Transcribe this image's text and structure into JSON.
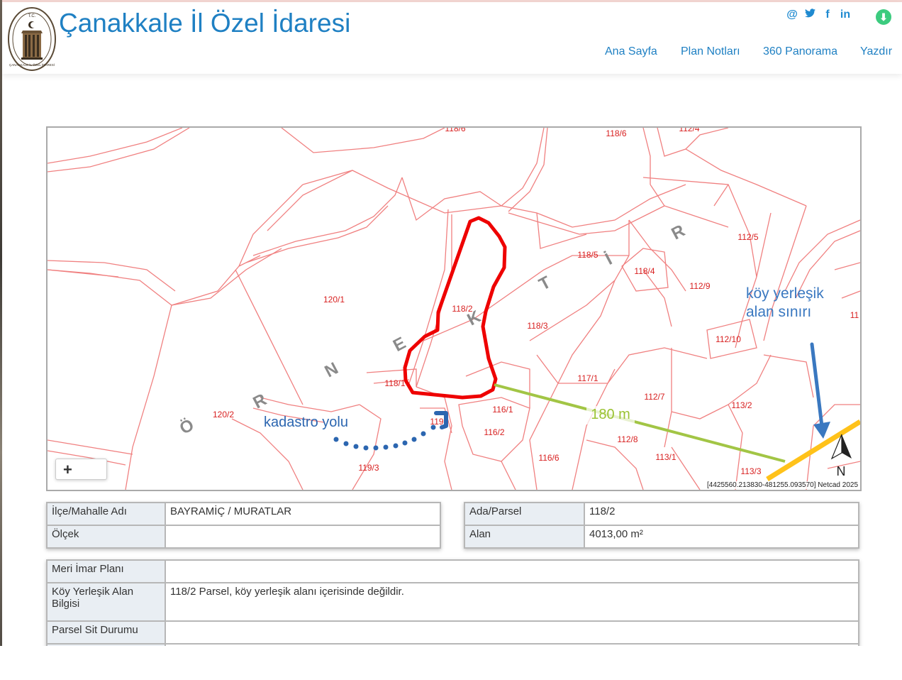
{
  "header": {
    "title": "Çanakkale İl Özel İdaresi",
    "logo_text": "T.C. ÇANAKKALE İL ÖZEL İDARESİ",
    "social": [
      "@",
      "twitter",
      "f",
      "in"
    ],
    "nav": [
      "Ana Sayfa",
      "Plan Notları",
      "360 Panorama",
      "Yazdır"
    ]
  },
  "map": {
    "parcels": [
      "118/6",
      "112/4",
      "118/5",
      "118/4",
      "112/5",
      "112/9",
      "120/1",
      "118/2",
      "118/3",
      "112/10",
      "117/1",
      "118/1",
      "116/1",
      "112/7",
      "113/2",
      "120/2",
      "119",
      "116/2",
      "112/8",
      "116/6",
      "113/1",
      "119/3",
      "113/3",
      "11"
    ],
    "street_letters": [
      "Ö",
      "R",
      "N",
      "E",
      "K",
      "T",
      "İ",
      "R"
    ],
    "annotations": {
      "village_boundary": [
        "köy yerleşik",
        "alan sınırı"
      ],
      "cadastral_road": "kadastro yolu",
      "distance": "180 m",
      "north": "N"
    },
    "zoom_label": "+",
    "credit": "[4425560.213830-481255.093570] Netcad 2025",
    "colors": {
      "parcel_line": "#f08080",
      "selected": "#ee0000",
      "distance_line": "#a2c545",
      "boundary": "#ffc21a",
      "arrow": "#3a78c0"
    }
  },
  "table_left": [
    {
      "label": "İlçe/Mahalle Adı",
      "value": "BAYRAMİÇ / MURATLAR"
    },
    {
      "label": "Ölçek",
      "value": ""
    }
  ],
  "table_right": [
    {
      "label": "Ada/Parsel",
      "value": "118/2"
    },
    {
      "label": "Alan",
      "value": "4013,00 m²"
    }
  ],
  "table_bottom": [
    {
      "label": "Meri İmar Planı",
      "value": ""
    },
    {
      "label": "Köy Yerleşik Alan Bilgisi",
      "value": "118/2 Parsel, köy yerleşik alanı içerisinde değildir."
    },
    {
      "label": "Parsel Sit Durumu",
      "value": ""
    },
    {
      "label": "",
      "value": ""
    }
  ]
}
